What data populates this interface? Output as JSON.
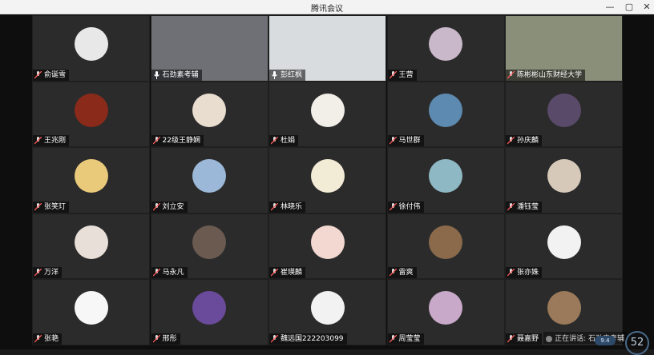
{
  "window": {
    "title": "腾讯会议"
  },
  "participants": [
    {
      "name": "俞诞雪"
    },
    {
      "name": "石劲素考辅"
    },
    {
      "name": "彭红枫"
    },
    {
      "name": "王营"
    },
    {
      "name": "陈彬彬山东财经大学"
    },
    {
      "name": "王兆刚"
    },
    {
      "name": "22级王静娴"
    },
    {
      "name": "杜娟"
    },
    {
      "name": "马世群"
    },
    {
      "name": "孙庆麟"
    },
    {
      "name": "张笑玎"
    },
    {
      "name": "刘立安"
    },
    {
      "name": "林晓乐"
    },
    {
      "name": "徐付伟"
    },
    {
      "name": "潘钰莹"
    },
    {
      "name": "万洋"
    },
    {
      "name": "马永凡"
    },
    {
      "name": "崔瑛麟"
    },
    {
      "name": "雷爽"
    },
    {
      "name": "张亦姝"
    },
    {
      "name": "张艳"
    },
    {
      "name": "邢彤"
    },
    {
      "name": "魏远国222203099"
    },
    {
      "name": "周莹莹"
    },
    {
      "name": "聂嘉野"
    }
  ],
  "status": {
    "speaking": "正在讲话: 石劲素考辅",
    "net": "9.4",
    "count": "52"
  }
}
